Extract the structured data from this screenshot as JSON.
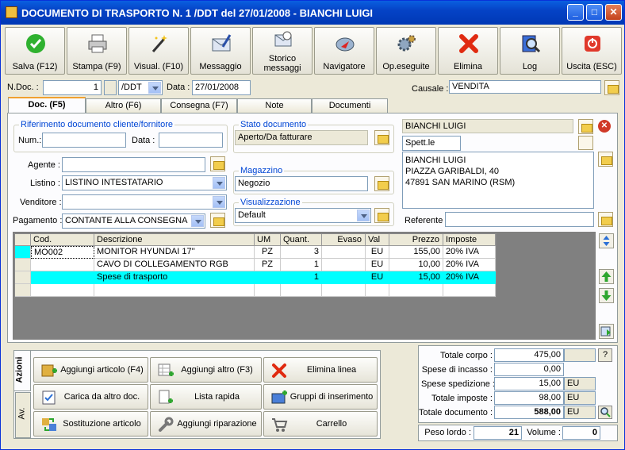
{
  "window": {
    "title": "DOCUMENTO DI TRASPORTO N. 1 /DDT del 27/01/2008 - BIANCHI LUIGI"
  },
  "toolbar": [
    {
      "label": "Salva (F12)",
      "icon": "check-icon"
    },
    {
      "label": "Stampa (F9)",
      "icon": "printer-icon"
    },
    {
      "label": "Visual. (F10)",
      "icon": "magic-wand-icon"
    },
    {
      "label": "Messaggio",
      "icon": "envelope-pen-icon"
    },
    {
      "label": "Storico messaggi",
      "icon": "message-history-icon"
    },
    {
      "label": "Navigatore",
      "icon": "compass-icon"
    },
    {
      "label": "Op.eseguite",
      "icon": "gears-icon"
    },
    {
      "label": "Elimina",
      "icon": "red-x-icon"
    },
    {
      "label": "Log",
      "icon": "log-magnifier-icon"
    },
    {
      "label": "Uscita (ESC)",
      "icon": "exit-icon"
    }
  ],
  "header": {
    "ndoc_label": "N.Doc. :",
    "ndoc_value": "1",
    "series_value": "/DDT",
    "data_label": "Data :",
    "data_value": "27/01/2008",
    "causale_label": "Causale :",
    "causale_value": "VENDITA"
  },
  "tabs": [
    "Doc. (F5)",
    "Altro (F6)",
    "Consegna (F7)",
    "Note",
    "Documenti"
  ],
  "riferimento": {
    "title": "Riferimento documento cliente/fornitore",
    "num_label": "Num.:",
    "num_value": "",
    "data_label": "Data :",
    "data_value": ""
  },
  "left_fields": {
    "agente_label": "Agente :",
    "agente_value": "",
    "listino_label": "Listino :",
    "listino_value": "LISTINO INTESTATARIO",
    "venditore_label": "Venditore :",
    "venditore_value": "",
    "pagamento_label": "Pagamento :",
    "pagamento_value": "CONTANTE ALLA CONSEGNA"
  },
  "stato": {
    "title": "Stato documento",
    "value": "Aperto/Da fatturare"
  },
  "magazzino": {
    "title": "Magazzino",
    "value": "Negozio"
  },
  "visualizzazione": {
    "title": "Visualizzazione",
    "value": "Default"
  },
  "customer": {
    "name": "BIANCHI LUIGI",
    "salutation": "Spett.le",
    "address": [
      "BIANCHI LUIGI",
      "PIAZZA GARIBALDI, 40",
      "47891 SAN MARINO (RSM)"
    ],
    "referente_label": "Referente",
    "referente_value": ""
  },
  "grid": {
    "columns": [
      "Cod.",
      "Descrizione",
      "UM",
      "Quant.",
      "Evaso",
      "Val",
      "Prezzo",
      "Imposte"
    ],
    "rows": [
      {
        "cod": "MO002",
        "desc": "MONITOR HYUNDAI 17''",
        "um": "PZ",
        "qty": "3",
        "evaso": "",
        "val": "EU",
        "prezzo": "155,00",
        "imposte": "20% IVA"
      },
      {
        "cod": "",
        "desc": "CAVO DI COLLEGAMENTO RGB",
        "um": "PZ",
        "qty": "1",
        "evaso": "",
        "val": "EU",
        "prezzo": "10,00",
        "imposte": "20% IVA"
      },
      {
        "cod": "",
        "desc": "Spese di trasporto",
        "um": "",
        "qty": "1",
        "evaso": "",
        "val": "EU",
        "prezzo": "15,00",
        "imposte": "20% IVA"
      },
      {
        "cod": "",
        "desc": "",
        "um": "",
        "qty": "",
        "evaso": "",
        "val": "",
        "prezzo": "",
        "imposte": ""
      }
    ]
  },
  "side_tabs": [
    "Azioni",
    "Av."
  ],
  "actions": [
    {
      "label": "Aggiungi articolo (F4)",
      "icon": "add-article-icon"
    },
    {
      "label": "Aggiungi altro (F3)",
      "icon": "add-other-icon"
    },
    {
      "label": "Elimina linea",
      "icon": "delete-line-icon"
    },
    {
      "label": "Carica da altro doc.",
      "icon": "load-doc-icon"
    },
    {
      "label": "Lista rapida",
      "icon": "quick-list-icon"
    },
    {
      "label": "Gruppi di inserimento",
      "icon": "insert-groups-icon"
    },
    {
      "label": "Sostituzione articolo",
      "icon": "replace-article-icon"
    },
    {
      "label": "Aggiungi riparazione",
      "icon": "wrench-icon"
    },
    {
      "label": "Carrello",
      "icon": "cart-icon"
    }
  ],
  "totals": {
    "corpo_label": "Totale corpo :",
    "corpo_value": "475,00",
    "help": "?",
    "incasso_label": "Spese di incasso :",
    "incasso_value": "0,00",
    "spedizione_label": "Spese spedizione :",
    "spedizione_value": "15,00",
    "spedizione_unit": "EU",
    "imposte_label": "Totale imposte :",
    "imposte_value": "98,00",
    "imposte_unit": "EU",
    "documento_label": "Totale documento :",
    "documento_value": "588,00",
    "documento_unit": "EU",
    "peso_label": "Peso lordo :",
    "peso_value": "21",
    "volume_label": "Volume :",
    "volume_value": "0"
  },
  "colors": {
    "title_blue": "#0543c6",
    "selected_row": "#00ffff",
    "group_title": "#0046d5"
  }
}
